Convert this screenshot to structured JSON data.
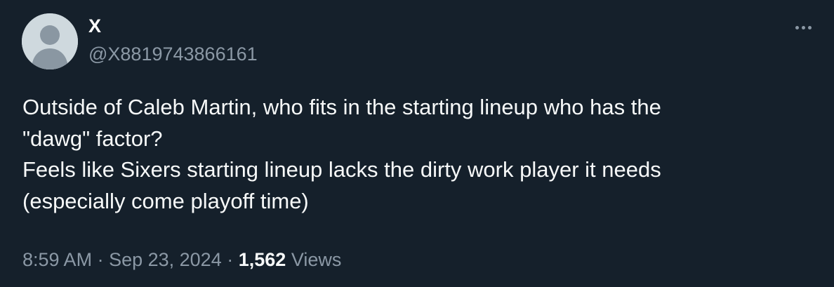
{
  "author": {
    "name": "X",
    "handle": "@X8819743866161",
    "avatar_icon": "default-avatar-icon"
  },
  "menu": {
    "icon": "more-horizontal-icon"
  },
  "tweet": {
    "lines": [
      "Outside of Caleb Martin, who fits in the starting lineup who has the",
      "\"dawg\" factor?",
      "Feels like Sixers starting lineup lacks the dirty work player it needs",
      "(especially come playoff time)"
    ]
  },
  "meta": {
    "time": "8:59 AM",
    "separator": " · ",
    "date": "Sep 23, 2024",
    "views_count": "1,562",
    "views_label": "Views"
  },
  "colors": {
    "background": "#15202b",
    "primary_text": "#f7f9f9",
    "secondary_text": "#8b98a5",
    "avatar_bg": "#cfd9de",
    "avatar_fg": "#8a97a2"
  }
}
